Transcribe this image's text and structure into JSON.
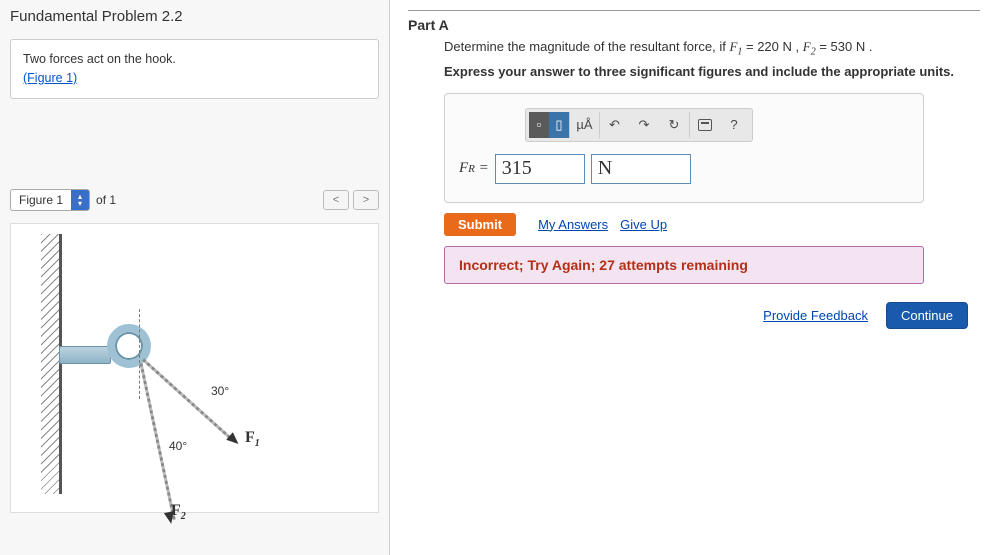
{
  "left": {
    "title": "Fundamental Problem 2.2",
    "prompt_line1": "Two forces act on the hook.",
    "figure_link_text": "(Figure 1)",
    "figure": {
      "selector_label": "Figure 1",
      "of_text": "of 1",
      "angle1": "30°",
      "angle2": "40°",
      "f1_label": "F",
      "f1_sub": "1",
      "f2_label": "F",
      "f2_sub": "2"
    }
  },
  "right": {
    "part_label": "Part A",
    "question_prefix": "Determine the magnitude of the resultant force, if ",
    "f1_sym": "F",
    "f1_sub": "1",
    "f1_val": " = 220 N",
    "sep": " , ",
    "f2_sym": "F",
    "f2_sub": "2",
    "f2_val": " = 530 N",
    "q_suffix": " .",
    "instruction": "Express your answer to three significant figures and include the appropriate units.",
    "toolbar": {
      "units_btn": "µÅ",
      "undo": "↶",
      "redo": "↷",
      "reset": "↻",
      "help": "?"
    },
    "fr_prefix": "F",
    "fr_sub": "R",
    "eq": " = ",
    "value_input": "315",
    "unit_input": "N",
    "submit": "Submit",
    "my_answers": "My Answers",
    "give_up": "Give Up",
    "feedback": "Incorrect; Try Again; 27 attempts remaining",
    "provide_feedback": "Provide Feedback",
    "continue": "Continue"
  }
}
